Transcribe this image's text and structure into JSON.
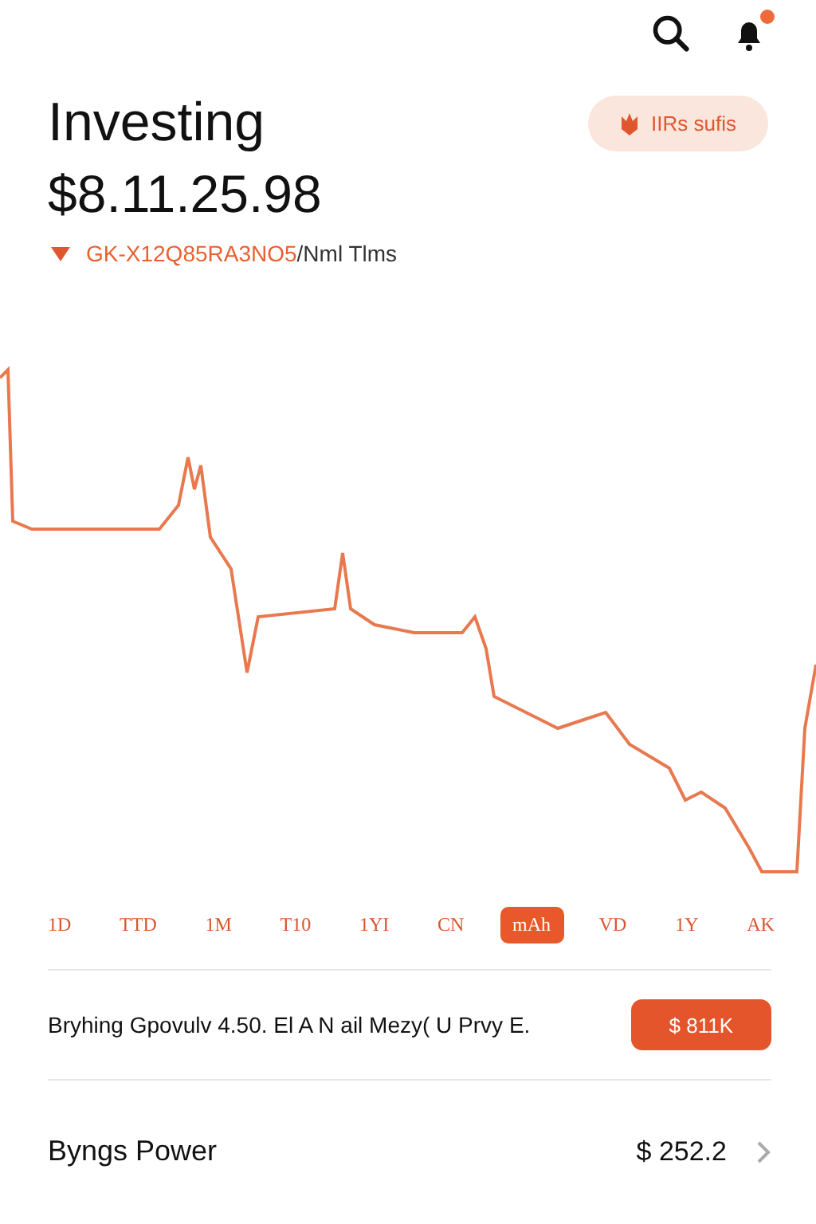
{
  "header": {
    "notification_dot": true
  },
  "title": "Investing",
  "pill": {
    "label": "IIRs sufis"
  },
  "value": "$8.11.25.98",
  "change": {
    "down": true,
    "amount": "GK-X12Q85RA3NO5",
    "period": "/Nml Tlms"
  },
  "ranges": [
    {
      "label": "1D",
      "selected": false
    },
    {
      "label": "TTD",
      "selected": false
    },
    {
      "label": "1M",
      "selected": false
    },
    {
      "label": "T10",
      "selected": false
    },
    {
      "label": "1YI",
      "selected": false
    },
    {
      "label": "CN",
      "selected": false
    },
    {
      "label": "mAh",
      "selected": true
    },
    {
      "label": "VD",
      "selected": false
    },
    {
      "label": "1Y",
      "selected": false
    },
    {
      "label": "AK",
      "selected": false
    }
  ],
  "promo": {
    "text": "Bryhing Gpovulv 4.50. El A N ail Mezy( U Prvy E.",
    "button": "$ 811K"
  },
  "buying_power": {
    "label": "Byngs Power",
    "value": "$ 252.2"
  }
}
